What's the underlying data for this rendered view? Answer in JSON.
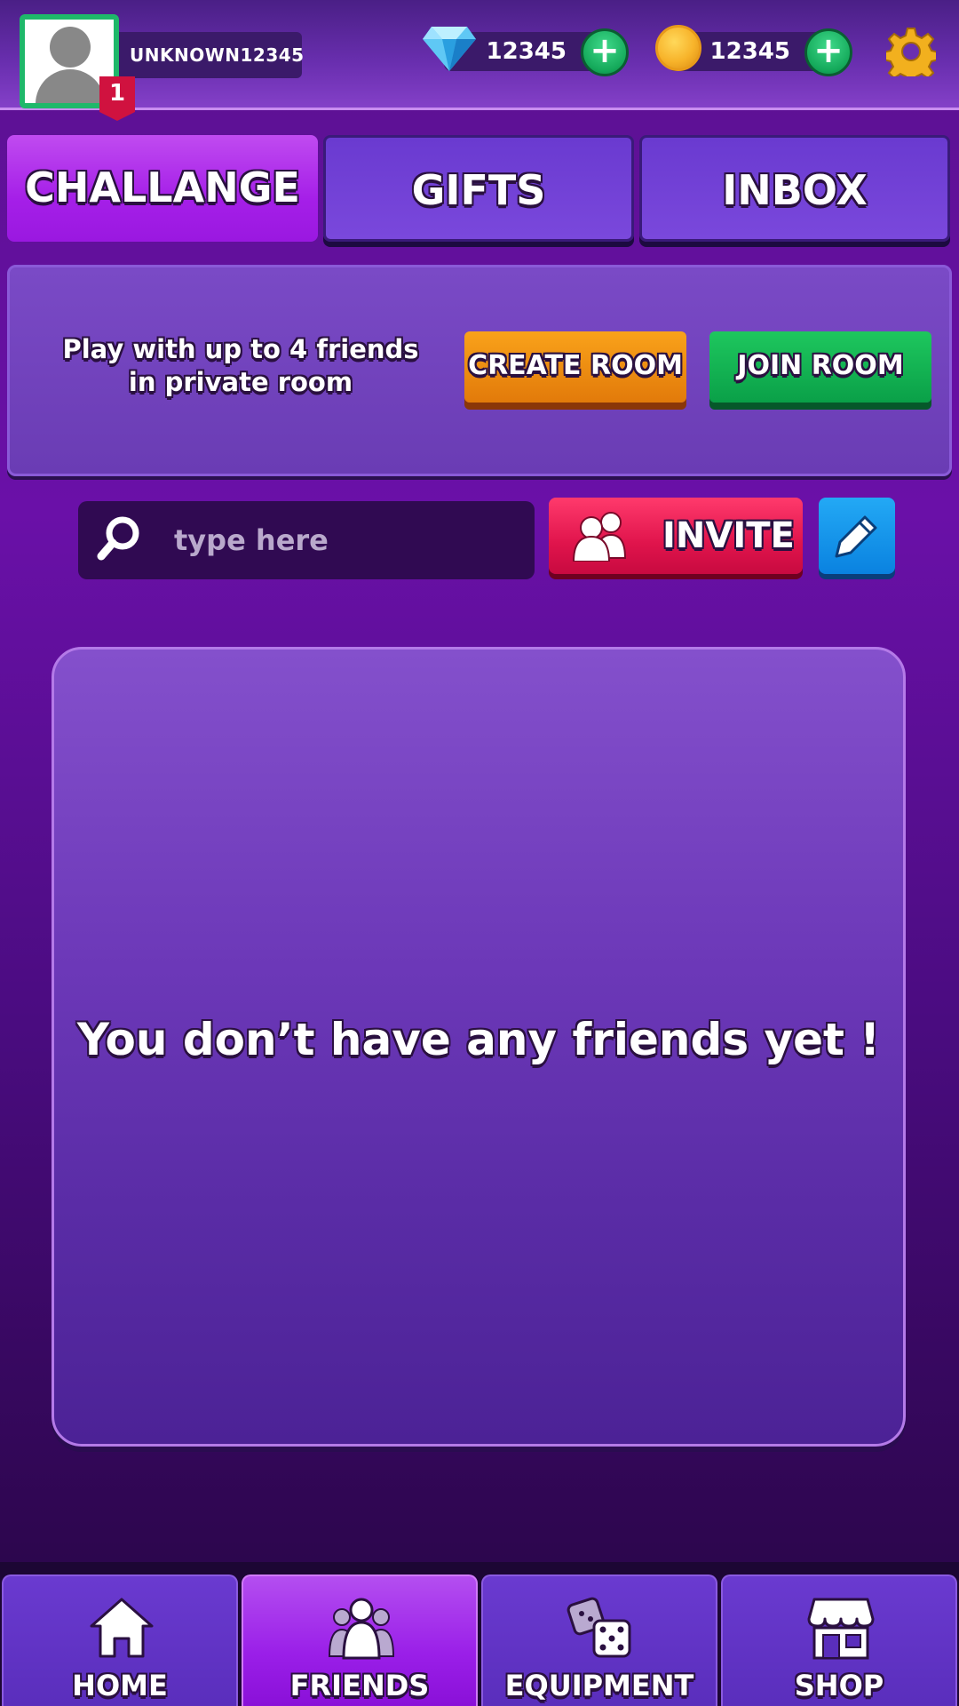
{
  "player": {
    "username": "UNKNOWN12345",
    "level": "1"
  },
  "currency": {
    "gems": "12345",
    "coins": "12345",
    "plus_label": "+"
  },
  "tabs": [
    {
      "label": "CHALLANGE",
      "active": true
    },
    {
      "label": "GIFTS",
      "active": false
    },
    {
      "label": "INBOX",
      "active": false
    }
  ],
  "private_room": {
    "description": "Play with up to 4 friends in private room",
    "create_label": "CREATE ROOM",
    "join_label": "JOIN ROOM"
  },
  "search": {
    "placeholder": "type here",
    "invite_label": "INVITE"
  },
  "friends": {
    "empty_message": "You don’t have any friends yet !"
  },
  "nav": [
    {
      "label": "HOME",
      "icon": "home-icon",
      "active": false
    },
    {
      "label": "FRIENDS",
      "icon": "friends-icon",
      "active": true
    },
    {
      "label": "EQUIPMENT",
      "icon": "dice-icon",
      "active": false
    },
    {
      "label": "SHOP",
      "icon": "shop-icon",
      "active": false
    }
  ],
  "colors": {
    "active_tab": "#a51fe8",
    "create_button": "#e27a0a",
    "join_button": "#0aa048",
    "invite_button": "#e0144c",
    "edit_button": "#0a82e0",
    "avatar_border": "#1fb86a",
    "level_badge": "#d0123f"
  }
}
